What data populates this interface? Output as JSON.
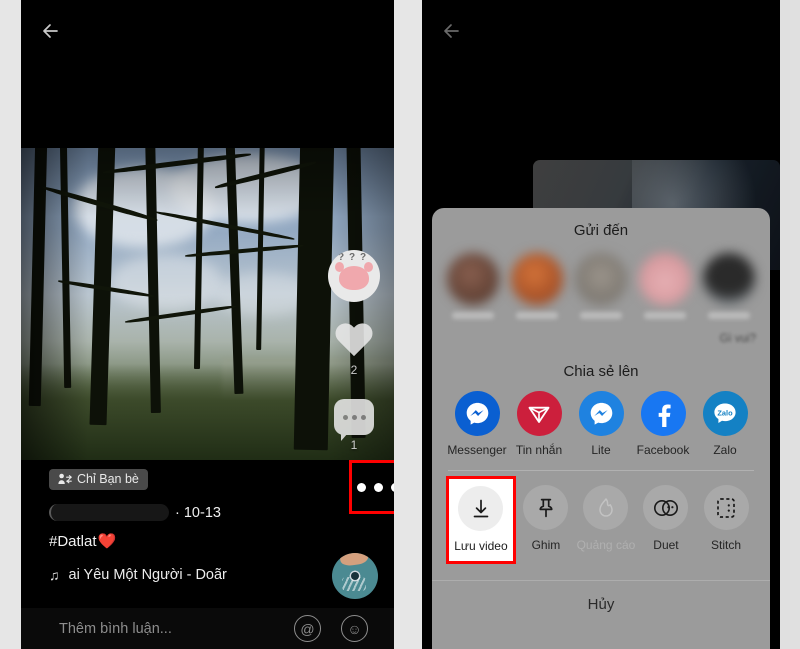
{
  "left_panel": {
    "back_icon": "back-arrow-icon",
    "privacy_badge": {
      "label": "Chỉ Bạn bè",
      "icon": "friends-privacy-icon"
    },
    "author": {
      "name_redacted": true,
      "date": "· 10-13"
    },
    "caption": "#Datlat",
    "caption_emoji": "❤️",
    "sound": {
      "icon": "music-note-icon",
      "title": "ai Yêu Một Người - Doãr"
    },
    "rail": {
      "avatar": "profile-avatar",
      "like": {
        "icon": "heart-icon",
        "count": "2"
      },
      "comment": {
        "icon": "comment-bubble-icon",
        "count": "1"
      }
    },
    "more_button": {
      "icon": "more-options-icon",
      "highlighted": true
    },
    "comment_bar": {
      "placeholder": "Thêm bình luận...",
      "mention_icon": "@",
      "emoji_icon": "☺"
    }
  },
  "right_panel": {
    "back_icon": "back-arrow-icon",
    "sheet": {
      "send_to_title": "Gửi đến",
      "contacts": [
        {
          "name_blurred": true,
          "color": "#6b4a3c"
        },
        {
          "name_blurred": true,
          "color": "#b4562c"
        },
        {
          "name_blurred": true,
          "color": "#8e8880"
        },
        {
          "name_blurred": true,
          "color": "#d9a0a4"
        },
        {
          "name_blurred": true,
          "color": "#191919"
        }
      ],
      "gi_vui": "Gì vui?",
      "share_to_title": "Chia sẻ lên",
      "share_targets": [
        {
          "label": "Messenger",
          "icon": "messenger-icon",
          "bg": "#0a5fd1",
          "fg": "#ffffff"
        },
        {
          "label": "Tin nhắn",
          "icon": "tin-nhan-icon",
          "bg": "#cc1f3c",
          "fg": "#ffffff"
        },
        {
          "label": "Lite",
          "icon": "messenger-lite-icon",
          "bg": "#1f82e0",
          "fg": "#ffffff"
        },
        {
          "label": "Facebook",
          "icon": "facebook-icon",
          "bg": "#1877f2",
          "fg": "#ffffff"
        },
        {
          "label": "Zalo",
          "icon": "zalo-icon",
          "bg": "#1481c4",
          "fg": "#ffffff"
        }
      ],
      "actions": [
        {
          "label": "Lưu video",
          "icon": "download-icon",
          "selected": true,
          "disabled": false
        },
        {
          "label": "Ghim",
          "icon": "pin-icon",
          "selected": false,
          "disabled": false
        },
        {
          "label": "Quảng cáo",
          "icon": "flame-icon",
          "selected": false,
          "disabled": true
        },
        {
          "label": "Duet",
          "icon": "duet-icon",
          "selected": false,
          "disabled": false
        },
        {
          "label": "Stitch",
          "icon": "stitch-icon",
          "selected": false,
          "disabled": false
        }
      ],
      "cancel_label": "Hủy"
    }
  },
  "colors": {
    "highlight": "#ff0000",
    "sheet_bg": "#9b9b9b",
    "page_bg": "#e6e6e6"
  }
}
